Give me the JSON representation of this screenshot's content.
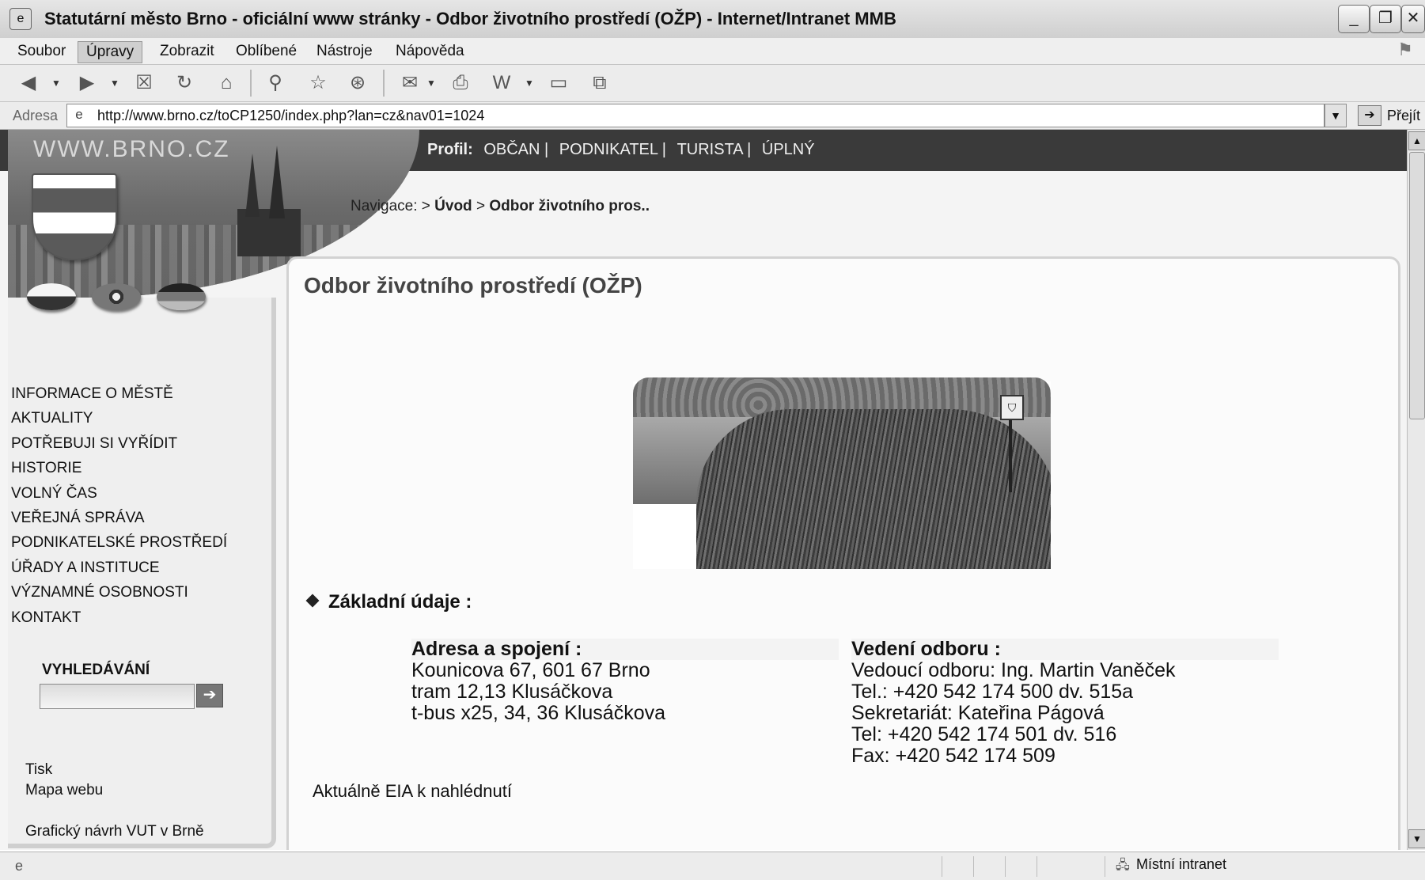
{
  "window": {
    "title": "Statutární město Brno - oficiální www stránky - Odbor životního prostředí (OŽP) - Internet/Intranet MMB",
    "minimize": "_",
    "restore": "❐",
    "close": "✕"
  },
  "menu": {
    "items": [
      "Soubor",
      "Úpravy",
      "Zobrazit",
      "Oblíbené",
      "Nástroje",
      "Nápověda"
    ],
    "active_index": 1
  },
  "toolbar": {
    "icons": [
      "back-icon",
      "forward-icon",
      "stop-icon",
      "refresh-icon",
      "home-icon",
      "search-icon",
      "favorites-icon",
      "history-icon",
      "mail-icon",
      "print-icon",
      "edit-icon",
      "discuss-icon",
      "messenger-icon"
    ]
  },
  "address": {
    "label": "Adresa",
    "url": "http://www.brno.cz/toCP1250/index.php?lan=cz&nav01=1024",
    "go_label": "Přejít"
  },
  "site": {
    "name": "WWW.BRNO.CZ",
    "profile_label": "Profil:",
    "profile_links": [
      "OBČAN |",
      "PODNIKATEL |",
      "TURISTA |",
      "ÚPLNÝ"
    ]
  },
  "breadcrumb": {
    "label": "Navigace: >",
    "home": "Úvod",
    "sep": ">",
    "current": "Odbor životního pros.."
  },
  "sidebar": {
    "nav": [
      "INFORMACE O MĚSTĚ",
      "AKTUALITY",
      "POTŘEBUJI SI VYŘÍDIT",
      "HISTORIE",
      "VOLNÝ ČAS",
      "VEŘEJNÁ SPRÁVA",
      "PODNIKATELSKÉ PROSTŘEDÍ",
      "ÚŘADY A INSTITUCE",
      "VÝZNAMNÉ OSOBNOSTI",
      "KONTAKT"
    ],
    "search_title": "VYHLEDÁVÁNÍ",
    "search_placeholder": "",
    "search_button": "➔",
    "print": "Tisk",
    "sitemap": "Mapa webu",
    "credit": "Grafický návrh VUT v Brně"
  },
  "content": {
    "title": "Odbor životního prostředí (OŽP)",
    "section": "Základní údaje :",
    "address": {
      "heading": "Adresa a spojení :",
      "lines": [
        "Kounicova 67, 601 67 Brno",
        "tram 12,13 Klusáčkova",
        "t-bus x25, 34, 36 Klusáčkova"
      ]
    },
    "leadership": {
      "heading": "Vedení odboru :",
      "lines": [
        "Vedoucí odboru: Ing. Martin Vaněček",
        "Tel.: +420 542 174 500 dv. 515a",
        "Sekretariát: Kateřina Págová",
        "Tel: +420 542 174 501 dv. 516",
        "Fax: +420 542 174 509"
      ]
    },
    "eia_link": "Aktuálně EIA k nahlédnutí"
  },
  "statusbar": {
    "zone": "Místní intranet"
  }
}
